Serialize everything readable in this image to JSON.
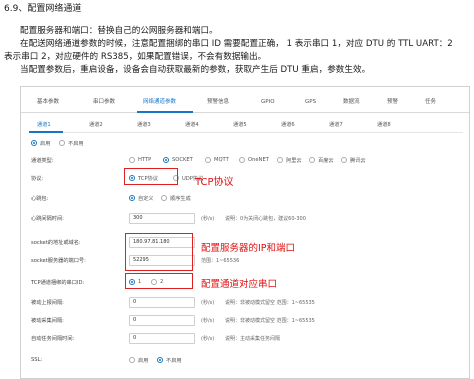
{
  "doc": {
    "heading": "6.9、配置网络通道",
    "lines": [
      "配置服务器和端口：替换自己的公网服务器和端口。",
      "在配送网络通道参数的时候，注意配置捆绑的串口 ID 需要配置正确， 1 表示串口 1，对应 DTU 的 TTL UART：2",
      "表示串口 2，对应硬件的 RS385，如果配置错误，不会有数据输出。",
      "当配置参数后，重启设备，设备会自动获取最新的参数，获取产生后 DTU 重启，参数生效。"
    ]
  },
  "screenshot": {
    "main_tabs": [
      "基本参数",
      "串口参数",
      "网络通道参数",
      "预警信息",
      "GPIO",
      "GPS",
      "数据流",
      "预警",
      "任务"
    ],
    "active_main_tab": "网络通道参数",
    "channel_tabs": [
      "通道1",
      "通道2",
      "通道3",
      "通道4",
      "通道5",
      "通道6",
      "通道7",
      "通道8"
    ],
    "active_channel_tab": "通道1",
    "enable": {
      "on_label": "启用",
      "off_label": "不启用"
    },
    "form": {
      "channel_type": {
        "label": "通道类型:",
        "options": [
          "HTTP",
          "SOCKET",
          "MQTT",
          "OneNET",
          "阿里云",
          "百度云",
          "腾讯云"
        ],
        "selected": "SOCKET"
      },
      "protocol": {
        "label": "协议:",
        "options": [
          "TCP协议",
          "UDP协议"
        ],
        "selected": "TCP协议"
      },
      "heartbeat": {
        "label": "心跳包:",
        "options": [
          "自定义",
          "顺序生成"
        ],
        "selected": "自定义"
      },
      "heartbeat_interval": {
        "label": "心跳间隔时间:",
        "value": "300",
        "unit": "(秒/s)",
        "hint": "说明：0为关闭心跳包，建议60-300"
      },
      "socket_address": {
        "label": "socket的地址或域名:",
        "value": "180.97.81.180"
      },
      "socket_port": {
        "label": "socket服务器的端口号:",
        "value": "52295",
        "hint": "范围：1~65536"
      },
      "serial_bind": {
        "label": "TCP通道捆绑的串口ID:",
        "options": [
          "1",
          "2"
        ],
        "selected": "1"
      },
      "passive_upload": {
        "label": "被动上报间隔:",
        "value": "0",
        "unit": "(秒/s)",
        "hint": "说明：非被动模式留空 范围：1~65535"
      },
      "passive_collect": {
        "label": "被动采集间隔:",
        "value": "0",
        "unit": "(秒/s)",
        "hint": "说明：非被动模式留空 范围：1~65535"
      },
      "active_task": {
        "label": "自动任务间隔时间:",
        "value": "0",
        "unit": "(秒/s)",
        "hint": "说明：主动采集任务间隔"
      },
      "ssl": {
        "label": "SSL:",
        "options": [
          "启用",
          "不启用"
        ],
        "selected": "不启用"
      }
    },
    "annotations": {
      "tcp": "TCP协议",
      "server": "配置服务器的IP和端口",
      "serial": "配置通道对应串口"
    },
    "colors": {
      "accent": "#1677c8",
      "annotation": "#e01010"
    }
  }
}
